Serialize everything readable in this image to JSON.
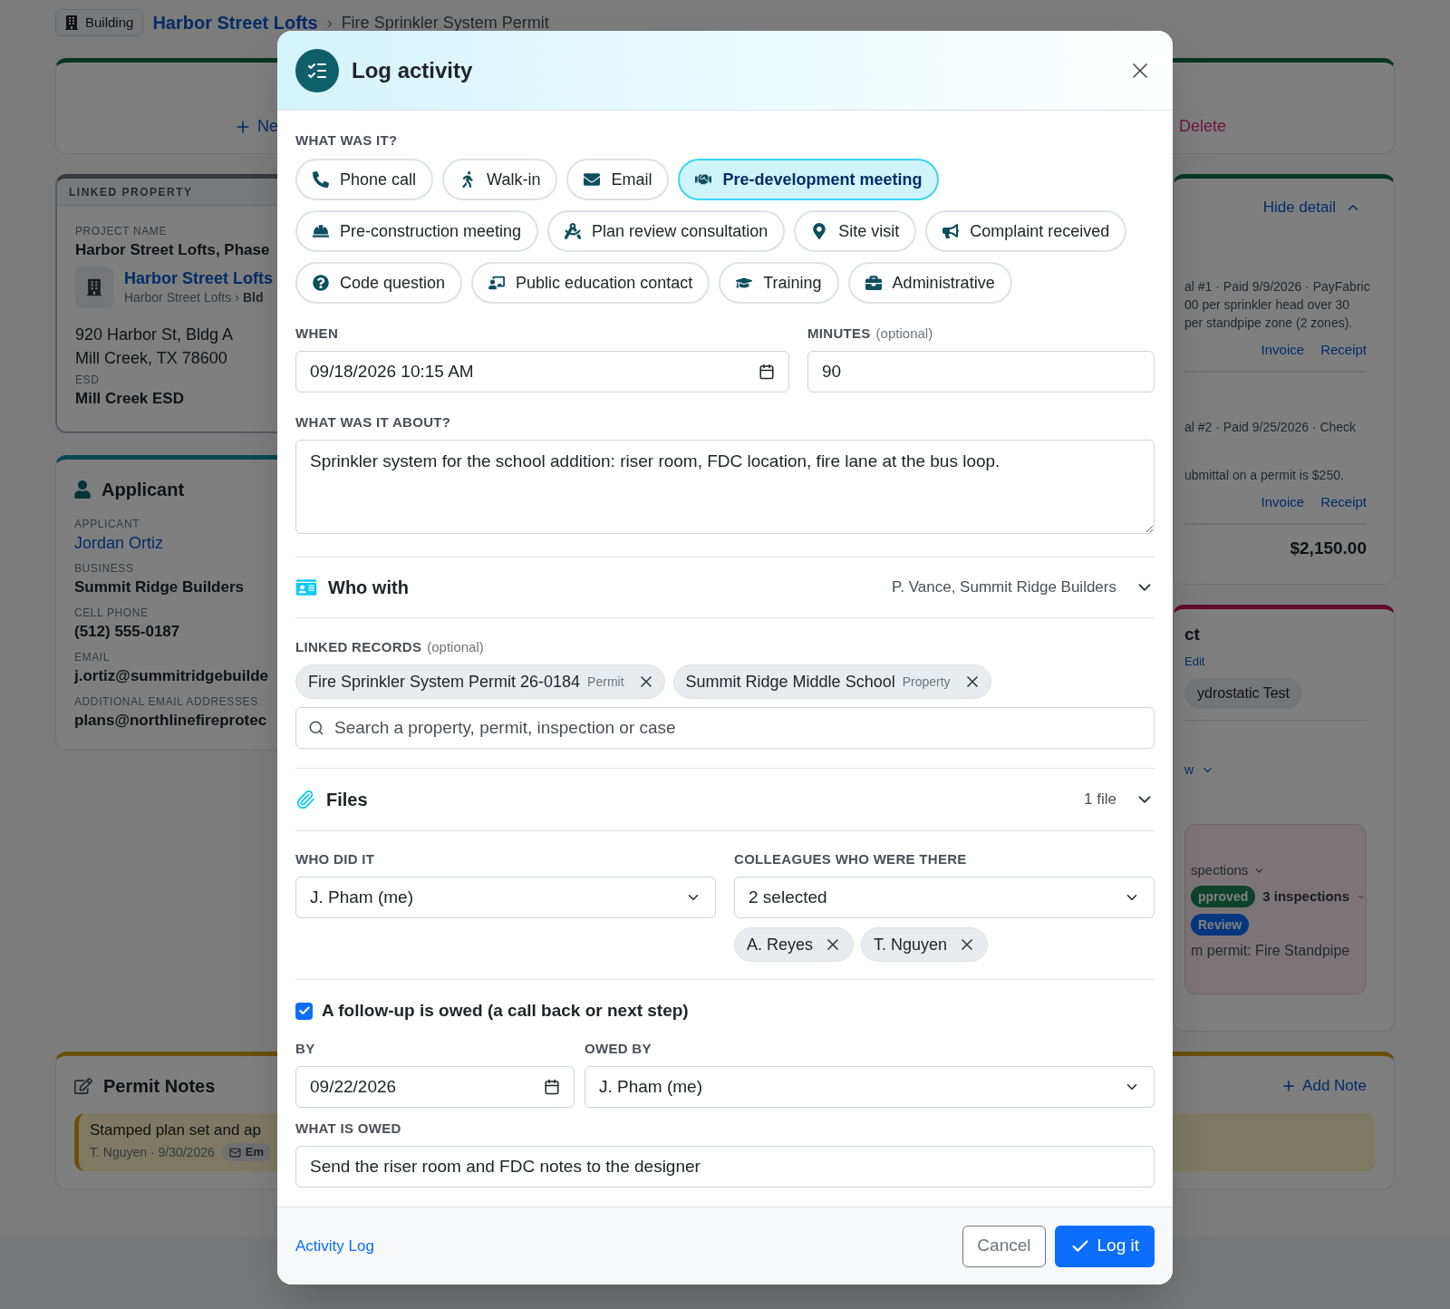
{
  "breadcrumb": {
    "badge": "Building",
    "link": "Harbor Street Lofts",
    "separator": "›",
    "current": "Fire Sprinkler System Permit"
  },
  "header_card": {
    "new_button": "Ne",
    "delete_button": "Delete"
  },
  "linked_property": {
    "heading": "LINKED PROPERTY",
    "project_label": "PROJECT NAME",
    "project_value": "Harbor Street Lofts, Phase",
    "property_link": "Harbor Street Lofts",
    "property_path": "Harbor Street Lofts",
    "property_path_sep": "›",
    "property_path_end": "Bld",
    "address_1": "920 Harbor St, Bldg A",
    "address_2": "Mill Creek, TX 78600",
    "esd_label": "ESD",
    "esd_value": "Mill Creek ESD"
  },
  "applicant": {
    "title": "Applicant",
    "fields": [
      {
        "label": "APPLICANT",
        "value": "Jordan Ortiz",
        "kind": "link"
      },
      {
        "label": "BUSINESS",
        "value": "Summit Ridge Builders",
        "kind": "text"
      },
      {
        "label": "CELL PHONE",
        "value": "(512) 555-0187",
        "kind": "text"
      },
      {
        "label": "EMAIL",
        "value": "j.ortiz@summitridgebuilde",
        "kind": "text"
      },
      {
        "label": "ADDITIONAL EMAIL ADDRESSES",
        "value": "plans@northlinefireprotec",
        "kind": "text"
      }
    ]
  },
  "fees_card": {
    "toggle": "Hide detail",
    "payments": [
      {
        "lines": [
          "al #1 · Paid 9/9/2026 · PayFabric",
          "00 per sprinkler head over 30",
          "per standpipe zone (2 zones)."
        ],
        "links": [
          "Invoice",
          "Receipt"
        ]
      },
      {
        "lines": [
          "al #2 · Paid 9/25/2026 · Check",
          "ubmittal on a permit is $250."
        ],
        "links": [
          "Invoice",
          "Receipt"
        ]
      }
    ],
    "total": "$2,150.00"
  },
  "inspections_card": {
    "title": "ct",
    "edit": "Edit",
    "chip": "ydrostatic Test",
    "toggle": "w",
    "box": {
      "heading": "spections",
      "status": "pproved",
      "count": "3 inspections",
      "review": "Review",
      "note": "m permit: Fire Standpipe"
    }
  },
  "permit_notes": {
    "title": "Permit Notes",
    "add_button": "Add Note",
    "note": {
      "text": "Stamped plan set and ap",
      "meta": "T. Nguyen · 9/30/2026",
      "tag": "Em"
    }
  },
  "dialog": {
    "title": "Log activity",
    "type_label": "WHAT WAS IT?",
    "types": [
      {
        "label": "Phone call",
        "selected": false
      },
      {
        "label": "Walk-in",
        "selected": false
      },
      {
        "label": "Email",
        "selected": false
      },
      {
        "label": "Pre-development meeting",
        "selected": true
      },
      {
        "label": "Pre-construction meeting",
        "selected": false
      },
      {
        "label": "Plan review consultation",
        "selected": false
      },
      {
        "label": "Site visit",
        "selected": false
      },
      {
        "label": "Complaint received",
        "selected": false
      },
      {
        "label": "Code question",
        "selected": false
      },
      {
        "label": "Public education contact",
        "selected": false
      },
      {
        "label": "Training",
        "selected": false
      },
      {
        "label": "Administrative",
        "selected": false
      }
    ],
    "when": {
      "label": "WHEN",
      "value": "09/18/2026 10:15 AM"
    },
    "minutes": {
      "label": "MINUTES",
      "hint": "(optional)",
      "value": "90"
    },
    "about": {
      "label": "WHAT WAS IT ABOUT?",
      "value": "Sprinkler system for the school addition: riser room, FDC location, fire lane at the bus loop."
    },
    "who_with": {
      "title": "Who with",
      "summary": "P. Vance, Summit Ridge Builders",
      "expanded": false
    },
    "linked_records": {
      "label": "LINKED RECORDS",
      "hint": "(optional)",
      "items": [
        {
          "name": "Fire Sprinkler System Permit 26-0184",
          "type": "Permit"
        },
        {
          "name": "Summit Ridge Middle School",
          "type": "Property"
        }
      ],
      "placeholder": "Search a property, permit, inspection or case"
    },
    "files": {
      "title": "Files",
      "summary": "1 file",
      "expanded": false
    },
    "who_did": {
      "label": "WHO DID IT",
      "value": "J. Pham (me)"
    },
    "colleagues": {
      "label": "COLLEAGUES WHO WERE THERE",
      "value": "2 selected",
      "chips": [
        "A. Reyes",
        "T. Nguyen"
      ]
    },
    "follow_up": {
      "checked": true,
      "label": "A follow-up is owed (a call back or next step)"
    },
    "by": {
      "label": "BY",
      "value": "09/22/2026"
    },
    "owed_by": {
      "label": "OWED BY",
      "value": "J. Pham (me)"
    },
    "what_owed": {
      "label": "WHAT IS OWED",
      "value": "Send the riser room and FDC notes to the designer"
    },
    "footer_link": "Activity Log",
    "cancel": "Cancel",
    "submit": "Log it"
  }
}
